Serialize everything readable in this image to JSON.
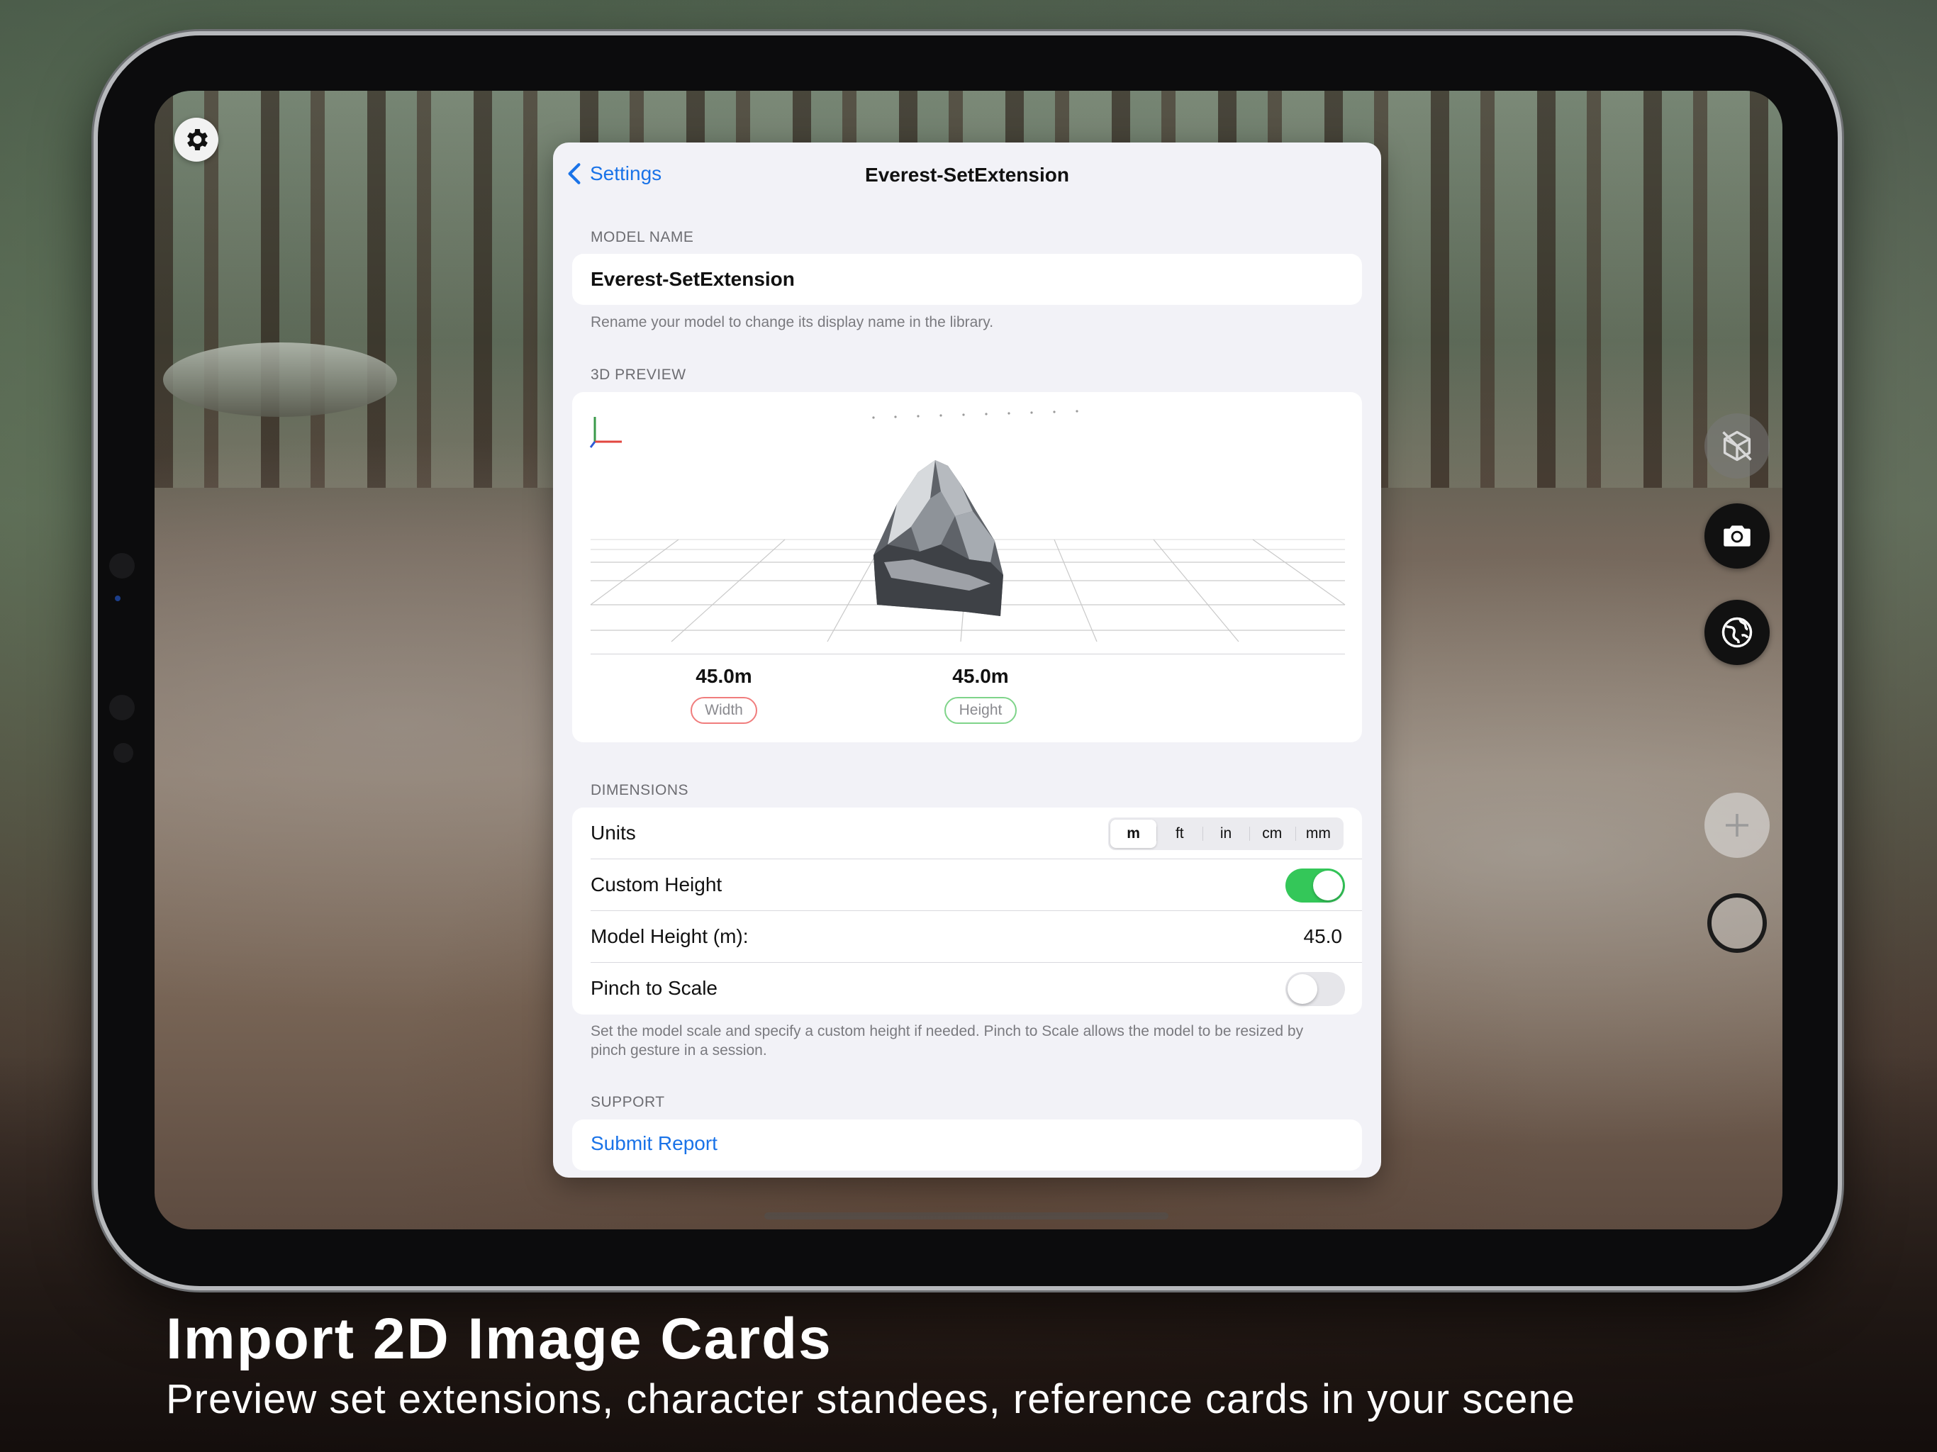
{
  "nav": {
    "back_label": "Settings",
    "title": "Everest-SetExtension"
  },
  "model_name": {
    "header": "MODEL NAME",
    "value": "Everest-SetExtension",
    "footnote": "Rename your model to change its display name in the library."
  },
  "preview": {
    "header": "3D PREVIEW",
    "width_value": "45.0m",
    "width_label": "Width",
    "height_value": "45.0m",
    "height_label": "Height"
  },
  "dimensions": {
    "header": "DIMENSIONS",
    "units_label": "Units",
    "units_options": [
      "m",
      "ft",
      "in",
      "cm",
      "mm"
    ],
    "units_selected": "m",
    "custom_height_label": "Custom Height",
    "custom_height_on": true,
    "model_height_label": "Model Height (m):",
    "model_height_value": "45.0",
    "pinch_label": "Pinch to Scale",
    "pinch_on": false,
    "footnote": "Set the model scale and specify a custom height if needed. Pinch to Scale allows the model to be resized by pinch gesture in a session."
  },
  "support": {
    "header": "SUPPORT",
    "submit_label": "Submit Report"
  },
  "caption": {
    "title": "Import 2D Image Cards",
    "subtitle": "Preview set extensions, character standees, reference cards in your scene"
  },
  "icons": {
    "gear": "gear-icon",
    "no_model": "cube-slash-icon",
    "camera": "camera-icon",
    "globe": "globe-icon",
    "add": "plus-icon",
    "back": "chevron-left-icon"
  },
  "colors": {
    "accent": "#1a73e8",
    "toggle_on": "#34c759",
    "width_pill": "#f07d7d",
    "height_pill": "#7fd48a"
  }
}
